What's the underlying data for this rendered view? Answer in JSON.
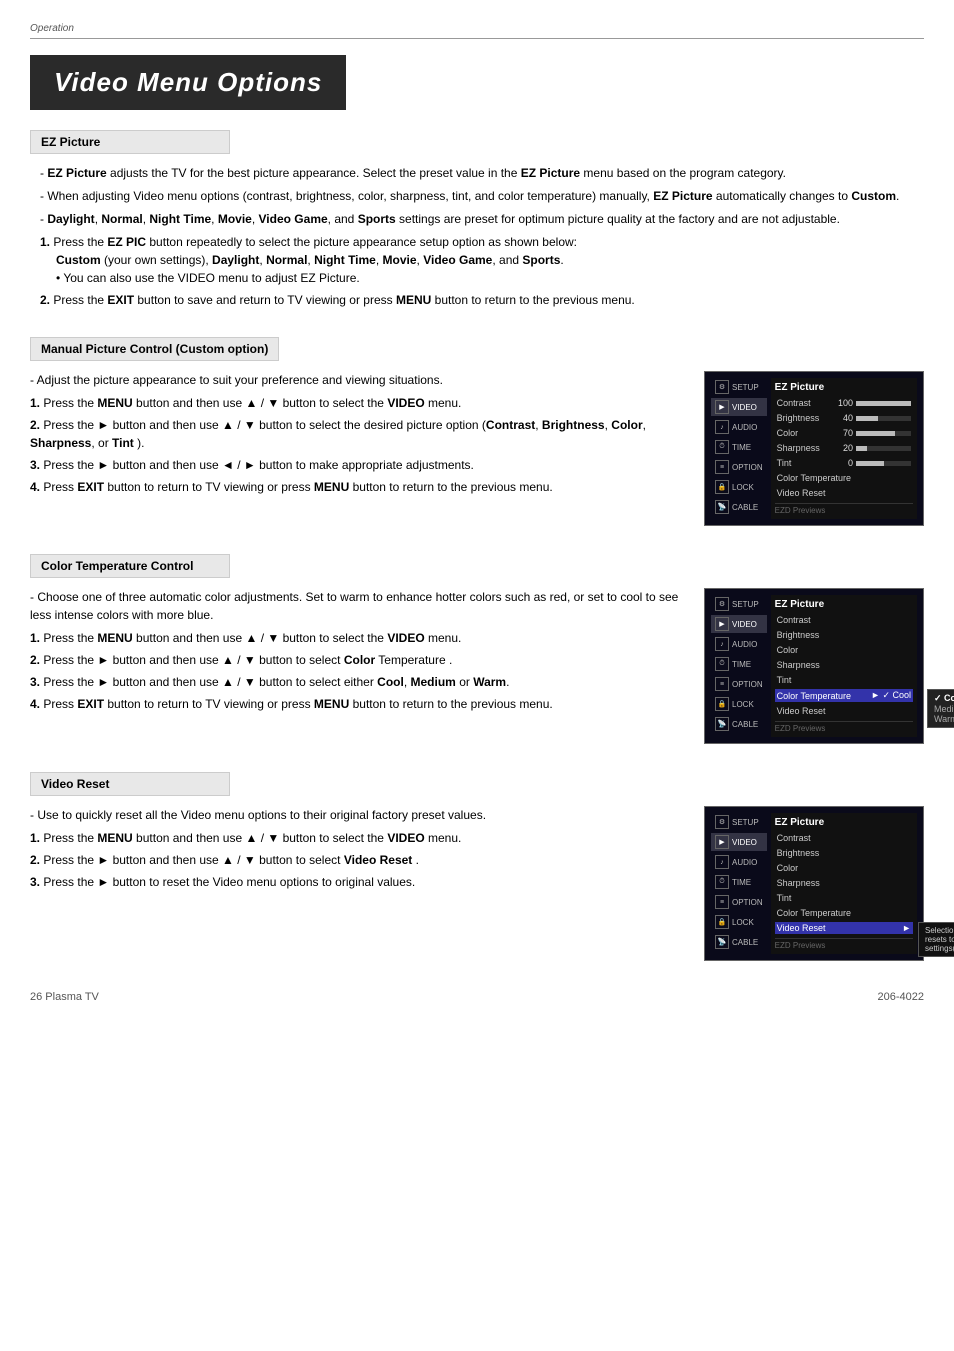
{
  "header": {
    "breadcrumb": "Operation"
  },
  "title": "Video Menu Options",
  "sections": [
    {
      "id": "ez-picture",
      "heading": "EZ Picture",
      "bullets": [
        "EZ Picture adjusts the TV for the best picture appearance. Select the preset value in the EZ Picture menu based on the program category.",
        "When adjusting Video menu options (contrast, brightness, color, sharpness, tint, and color temperature) manually, EZ Picture automatically changes to Custom.",
        "Daylight, Normal, Night Time, Movie, Video Game, and Sports settings are preset for optimum picture quality at the factory and are not adjustable."
      ],
      "steps": [
        {
          "num": "1.",
          "text": "Press the EZ PIC button repeatedly to select the picture appearance setup option as shown below:",
          "sub1": "Custom (your own settings), Daylight, Normal, Night Time, Movie, Video Game, and Sports.",
          "sub2": "• You can also use the VIDEO menu to adjust EZ Picture."
        },
        {
          "num": "2.",
          "text": "Press the EXIT button to save and return to TV viewing or press MENU button to return to the previous menu."
        }
      ]
    },
    {
      "id": "manual-picture",
      "heading": "Manual Picture Control (Custom option)",
      "bullets": [
        "Adjust the picture appearance to suit your preference and viewing situations."
      ],
      "steps": [
        {
          "num": "1.",
          "text": "Press the MENU button and then use ▲ / ▼ button to select the VIDEO menu."
        },
        {
          "num": "2.",
          "text": "Press the ► button and then use ▲ / ▼ button to select the desired picture option (Contrast, Brightness, Color, Sharpness, or Tint )."
        },
        {
          "num": "3.",
          "text": "Press the ► button and then use ◄ / ► button to make appropriate adjustments."
        },
        {
          "num": "4.",
          "text": "Press EXIT button to return to TV viewing or press MENU button to return to the previous menu."
        }
      ],
      "menu": {
        "title": "EZ Picture",
        "items": [
          {
            "label": "Contrast",
            "value": "100",
            "pct": 100
          },
          {
            "label": "Brightness",
            "value": "40",
            "pct": 40
          },
          {
            "label": "Color",
            "value": "70",
            "pct": 70
          },
          {
            "label": "Sharpness",
            "value": "20",
            "pct": 20
          },
          {
            "label": "Tint",
            "value": "0",
            "pct": 50
          },
          {
            "label": "Color Temperature",
            "value": "",
            "pct": -1
          },
          {
            "label": "Video Reset",
            "value": "",
            "pct": -1
          }
        ],
        "footnote": "EZD Previews"
      }
    },
    {
      "id": "color-temp",
      "heading": "Color Temperature Control",
      "bullets": [
        "Choose one of three automatic color adjustments. Set to warm to enhance hotter colors such as red, or set to cool to see less intense colors with more blue."
      ],
      "steps": [
        {
          "num": "1.",
          "text": "Press the MENU button and then use ▲ / ▼ button to select the VIDEO menu."
        },
        {
          "num": "2.",
          "text": "Press the ► button and then use ▲ / ▼ button to select Color Temperature ."
        },
        {
          "num": "3.",
          "text": "Press the ► button and then use ▲ / ▼ button to select either Cool, Medium or Warm."
        },
        {
          "num": "4.",
          "text": "Press EXIT button to return to TV viewing or press MENU button to return to the previous menu."
        }
      ],
      "menu": {
        "title": "EZ Picture",
        "items": [
          {
            "label": "Contrast",
            "value": "",
            "pct": -1
          },
          {
            "label": "Brightness",
            "value": "",
            "pct": -1
          },
          {
            "label": "Color",
            "value": "",
            "pct": -1
          },
          {
            "label": "Sharpness",
            "value": "",
            "pct": -1
          },
          {
            "label": "Tint",
            "value": "",
            "pct": -1
          },
          {
            "label": "Color Temperature",
            "value": "► ✓ Cool",
            "pct": -1,
            "highlight": true
          },
          {
            "label": "Video Reset",
            "value": "",
            "pct": -1
          }
        ],
        "submenu": [
          "Cool",
          "Medium",
          "Warm"
        ],
        "selected": "Cool",
        "footnote": "EZD Previews"
      }
    },
    {
      "id": "video-reset",
      "heading": "Video Reset",
      "bullets": [
        "Use to quickly reset all the Video menu options to their original factory preset values."
      ],
      "steps": [
        {
          "num": "1.",
          "text": "Press the MENU button and then use ▲ / ▼ button to select the VIDEO menu."
        },
        {
          "num": "2.",
          "text": "Press the ► button and then use ▲ / ▼ button to select Video Reset ."
        },
        {
          "num": "3.",
          "text": "Press the ► button to reset the Video menu options to original values."
        }
      ],
      "menu": {
        "title": "EZ Picture",
        "items": [
          {
            "label": "Contrast",
            "value": "",
            "pct": -1
          },
          {
            "label": "Brightness",
            "value": "",
            "pct": -1
          },
          {
            "label": "Color",
            "value": "",
            "pct": -1
          },
          {
            "label": "Sharpness",
            "value": "",
            "pct": -1
          },
          {
            "label": "Tint",
            "value": "",
            "pct": -1
          },
          {
            "label": "Color Temperature",
            "value": "",
            "pct": -1
          },
          {
            "label": "Video Reset",
            "value": "►",
            "pct": -1,
            "highlight": true
          }
        ],
        "note": "Selection (► or ◄) resets to the factory settings(defaults).",
        "footnote": "EZD Previews"
      }
    }
  ],
  "nav_items": [
    {
      "icon": "⚙",
      "label": "SETUP"
    },
    {
      "icon": "▶",
      "label": "VIDEO",
      "active": true
    },
    {
      "icon": "♪",
      "label": "AUDIO"
    },
    {
      "icon": "⏱",
      "label": "TIME"
    },
    {
      "icon": "≡",
      "label": "OPTION"
    },
    {
      "icon": "🔒",
      "label": "LOCK"
    },
    {
      "icon": "📡",
      "label": "CABLE"
    }
  ],
  "footer": {
    "left": "26    Plasma TV",
    "right": "206-4022"
  }
}
